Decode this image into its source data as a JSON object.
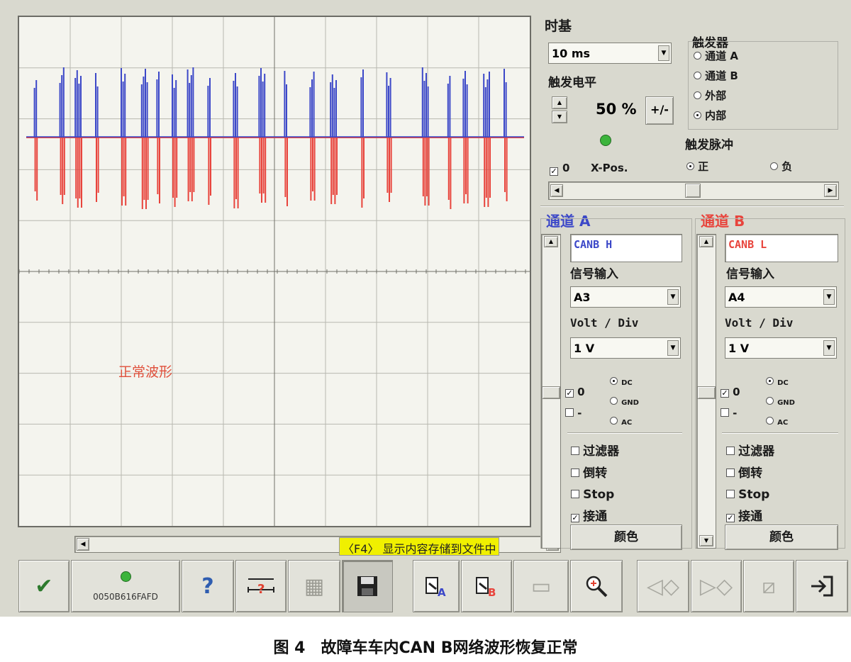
{
  "timebase": {
    "title": "时基",
    "value": "10 ms"
  },
  "trigger_level": {
    "title": "触发电平",
    "value": "50 %",
    "plusminus_label": "+/-"
  },
  "trigger_source": {
    "title": "触发器",
    "options": [
      "通道 A",
      "通道 B",
      "外部",
      "内部"
    ],
    "selected": "内部"
  },
  "trigger_pulse": {
    "title": "触发脉冲",
    "options": [
      "正",
      "负"
    ],
    "selected": "正"
  },
  "xpos": {
    "check": "0",
    "label": "X-Pos."
  },
  "scope": {
    "annotation": "正常波形"
  },
  "channel_a": {
    "title": "通道 A",
    "name": "CANB H",
    "signal_label": "信号输入",
    "signal_value": "A3",
    "vdiv_label": "Volt / Div",
    "vdiv_value": "1 V",
    "zero": "0",
    "minus": "-",
    "coupling": [
      "DC",
      "GND",
      "AC"
    ],
    "coupling_selected": "DC",
    "options": [
      "过滤器",
      "倒转",
      "Stop",
      "接通"
    ],
    "checked": [
      "接通"
    ],
    "color_button": "颜色"
  },
  "channel_b": {
    "title": "通道 B",
    "name": "CANB L",
    "signal_label": "信号输入",
    "signal_value": "A4",
    "vdiv_label": "Volt / Div",
    "vdiv_value": "1 V",
    "zero": "0",
    "minus": "-",
    "coupling": [
      "DC",
      "GND",
      "AC"
    ],
    "coupling_selected": "DC",
    "options": [
      "过滤器",
      "倒转",
      "Stop",
      "接通"
    ],
    "checked": [
      "接通"
    ],
    "color_button": "颜色"
  },
  "tooltip": "〈F4〉 显示内容存储到文件中",
  "toolbar": {
    "device_id": "0050B616FAFD"
  },
  "caption": "图 4　故障车车内CAN B网络波形恢复正常",
  "colors": {
    "channel_a": "#3c48c8",
    "channel_b": "#e8443c",
    "background": "#d9d9cf",
    "grid": "#b8b8b0"
  }
}
